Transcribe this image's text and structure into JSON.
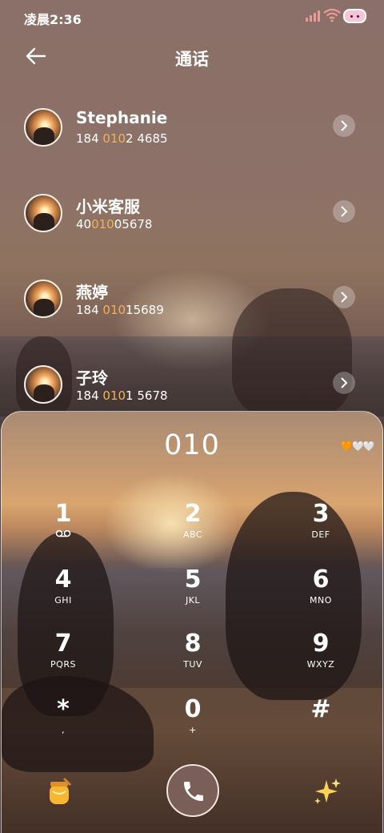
{
  "status_bar": {
    "time": "凌晨2:36",
    "icons": [
      "signal-icon",
      "wifi-icon",
      "battery-icon"
    ]
  },
  "header": {
    "title": "通话",
    "back_icon": "arrow-left-icon"
  },
  "contacts": [
    {
      "name": "Stephanie",
      "number_pre": "184 ",
      "number_hl": "010",
      "number_post": "2 4685"
    },
    {
      "name": "小米客服",
      "number_pre": "40",
      "number_hl": "010",
      "number_post": "05678"
    },
    {
      "name": "燕婷",
      "number_pre": "184 ",
      "number_hl": "010",
      "number_post": "15689"
    },
    {
      "name": "子玲",
      "number_pre": "184 ",
      "number_hl": "010",
      "number_post": "1 5678"
    }
  ],
  "dialer": {
    "input_value": "010",
    "decor": "🧡🤍🤍",
    "keys": [
      {
        "digit": "1",
        "letters": "⌕"
      },
      {
        "digit": "2",
        "letters": "ABC"
      },
      {
        "digit": "3",
        "letters": "DEF"
      },
      {
        "digit": "4",
        "letters": "GHI"
      },
      {
        "digit": "5",
        "letters": "JKL"
      },
      {
        "digit": "6",
        "letters": "MNO"
      },
      {
        "digit": "7",
        "letters": "PQRS"
      },
      {
        "digit": "8",
        "letters": "TUV"
      },
      {
        "digit": "9",
        "letters": "WXYZ"
      },
      {
        "digit": "*",
        "letters": ","
      },
      {
        "digit": "0",
        "letters": "+"
      },
      {
        "digit": "#",
        "letters": ""
      }
    ],
    "left_icon": "honey-jar-icon",
    "call_icon": "phone-icon",
    "right_icon": "sparkles-icon"
  },
  "colors": {
    "highlight": "#f1b15a",
    "call_button": "#7a5f58"
  }
}
